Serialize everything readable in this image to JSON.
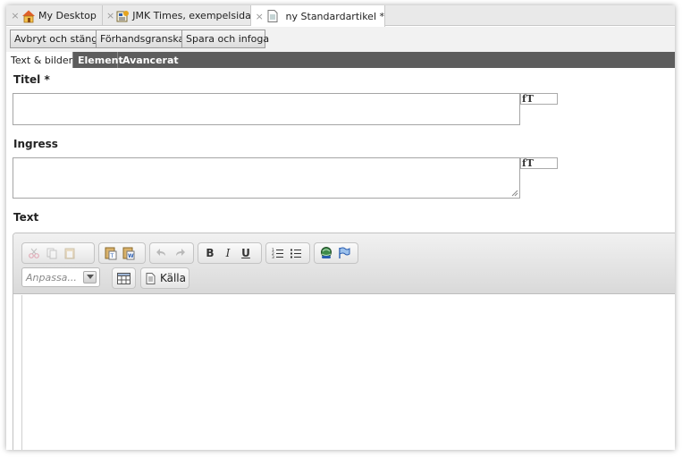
{
  "tabs": [
    {
      "label": "My Desktop",
      "icon": "house-icon",
      "active": false
    },
    {
      "label": "JMK Times, exempelsida",
      "icon": "newspaper-icon",
      "active": false
    },
    {
      "label": "ny Standardartikel  *",
      "icon": "document-icon",
      "active": true
    }
  ],
  "tab_close_glyph": "×",
  "toolbar": {
    "cancel_label": "Avbryt och stäng",
    "preview_label": "Förhandsgranska",
    "save_label": "Spara och infoga"
  },
  "section_tabs": [
    {
      "label": "Text & bilder",
      "active": true
    },
    {
      "label": "Element",
      "active": false
    },
    {
      "label": "Avancerat",
      "active": false
    }
  ],
  "form": {
    "title_label": "Titel *",
    "title_value": "",
    "ingress_label": "Ingress",
    "ingress_value": "",
    "text_label": "Text",
    "font_toggle_label": "fT"
  },
  "editor": {
    "format_combo_value": "Anpassa...",
    "source_label": "Källa",
    "bold_glyph": "B",
    "italic_glyph": "I",
    "underline_glyph": "U",
    "icons": [
      "cut-icon",
      "copy-icon",
      "paste-icon",
      "paste-text-icon",
      "paste-word-icon",
      "undo-icon",
      "redo-icon",
      "bold-icon",
      "italic-icon",
      "underline-icon",
      "numbered-list-icon",
      "bulleted-list-icon",
      "link-icon",
      "anchor-flag-icon",
      "table-icon",
      "source-icon",
      "dropdown-arrow-icon"
    ]
  },
  "colors": {
    "section_tab_bar": "#5d5d5d",
    "accent_blue": "#2a5db0"
  }
}
